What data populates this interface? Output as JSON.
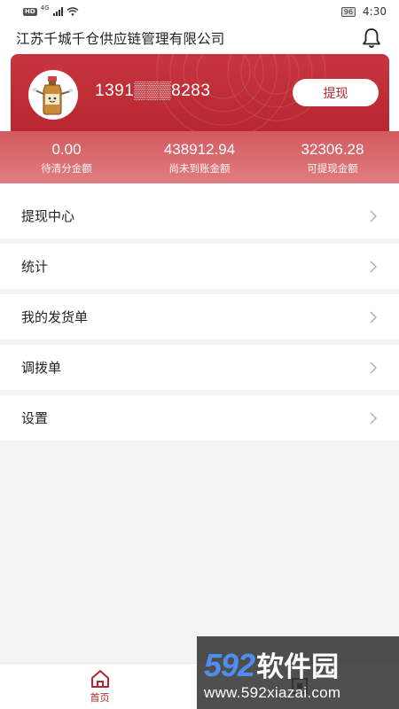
{
  "status_bar": {
    "network_badge": "HD",
    "network_type": "4G",
    "battery": "96",
    "time": "4:30"
  },
  "header": {
    "title": "江苏千城千仓供应链管理有限公司",
    "bell_icon": "bell-icon"
  },
  "card": {
    "phone": "1391▒▒▒8283",
    "withdraw_label": "提现",
    "accent_color": "#b5262f"
  },
  "stats": [
    {
      "value": "0.00",
      "label": "待清分金额"
    },
    {
      "value": "438912.94",
      "label": "尚未到账金额"
    },
    {
      "value": "32306.28",
      "label": "可提现金额"
    }
  ],
  "menu": [
    {
      "label": "提现中心"
    },
    {
      "label": "统计"
    },
    {
      "label": "我的发货单"
    },
    {
      "label": "调拨单"
    },
    {
      "label": "设置"
    }
  ],
  "bottom_nav": {
    "tabs": [
      {
        "label": "首页",
        "icon": "home-icon",
        "active": true
      },
      {
        "label": "",
        "icon": "qr-icon",
        "active": false
      }
    ]
  },
  "watermark": {
    "number": "592",
    "text": "软件园",
    "url": "www.592xiazai.com"
  }
}
